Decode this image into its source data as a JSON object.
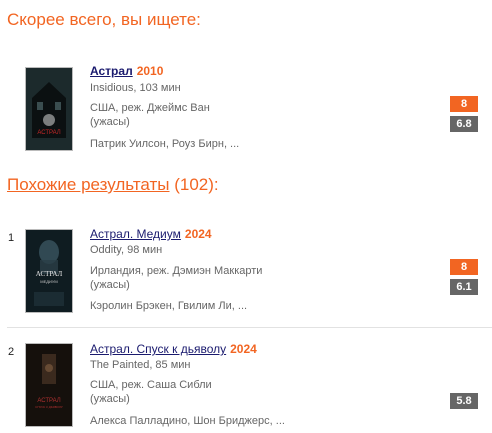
{
  "headings": {
    "best_match": "Скорее всего, вы ищете:",
    "similar_link": "Похожие результаты",
    "similar_count": "(102):"
  },
  "best": {
    "title": "Астрал",
    "year": "2010",
    "original": "Insidious, 103 мин",
    "country_director": "США, реж. Джеймс Ван",
    "genre": "(ужасы)",
    "cast": "Патрик Уилсон, Роуз Бирн, ...",
    "rating_orange": "8",
    "rating_gray": "6.8",
    "poster_text": "АСТРАЛ"
  },
  "results": [
    {
      "num": "1",
      "title": "Астрал. Медиум",
      "year": "2024",
      "original": "Oddity, 98 мин",
      "country_director": "Ирландия, реж. Дэмиэн Маккарти",
      "genre": "(ужасы)",
      "cast": "Кэролин Брэкен, Гвилим Ли, ...",
      "rating_orange": "8",
      "rating_gray": "6.1",
      "poster_text": "АСТРАЛ",
      "poster_subtext": "МЕДИУМ"
    },
    {
      "num": "2",
      "title": "Астрал. Спуск к дьяволу",
      "year": "2024",
      "original": "The Painted, 85 мин",
      "country_director": "США, реж. Саша Сибли",
      "genre": "(ужасы)",
      "cast": "Алекса Палладино, Шон Бриджерс, ...",
      "rating_gray": "5.8",
      "poster_text": "АСТРАЛ",
      "poster_subtext": "СПУСК К ДЬЯВОЛУ"
    }
  ],
  "colors": {
    "accent": "#f26522",
    "link": "#1a1a6e",
    "badge_gray": "#666666"
  }
}
